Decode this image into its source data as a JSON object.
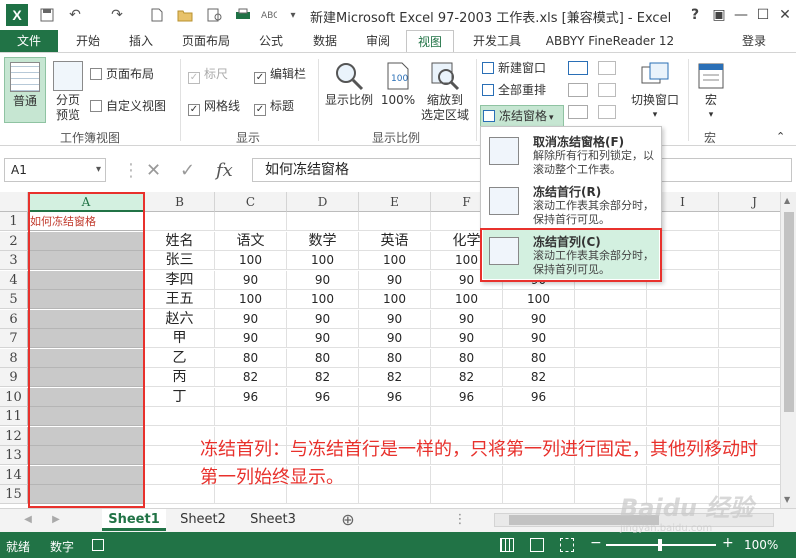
{
  "window": {
    "title": "新建Microsoft Excel 97-2003 工作表.xls  [兼容模式] - Excel",
    "help": "?",
    "ribbon_display": "▣",
    "minimize": "—",
    "maximize": "☐",
    "close": "✕"
  },
  "tabs": {
    "file": "文件",
    "items": [
      "开始",
      "插入",
      "页面布局",
      "公式",
      "数据",
      "审阅",
      "视图",
      "开发工具",
      "ABBYY FineReader 12"
    ],
    "login": "登录"
  },
  "ribbon": {
    "workbook_views": {
      "normal": "普通",
      "page_break": [
        "分页",
        "预览"
      ],
      "page_layout": "页面布局",
      "custom_views": "自定义视图",
      "group_label": "工作簿视图"
    },
    "show": {
      "ruler": "标尺",
      "formula_bar": "编辑栏",
      "gridlines": "网格线",
      "headings": "标题",
      "group_label": "显示"
    },
    "zoom": {
      "zoom": "显示比例",
      "zoom100": "100%",
      "zoom_to_selection": [
        "缩放到",
        "选定区域"
      ],
      "group_label": "显示比例"
    },
    "window": {
      "new_window": "新建窗口",
      "arrange_all": "全部重排",
      "freeze_panes": "冻结窗格",
      "switch_windows": "切换窗口"
    },
    "macros": {
      "macro": "宏",
      "group_label": "宏"
    }
  },
  "formula_bar": {
    "name_box": "A1",
    "cancel": "✕",
    "enter": "✓",
    "fx": "fx",
    "content": "如何冻结窗格"
  },
  "grid": {
    "columns": [
      "A",
      "B",
      "C",
      "D",
      "E",
      "F",
      "G",
      "H",
      "I",
      "J"
    ],
    "rows": [
      "1",
      "2",
      "3",
      "4",
      "5",
      "6",
      "7",
      "8",
      "9",
      "10",
      "11",
      "12",
      "13",
      "14",
      "15"
    ],
    "a1_text": "如何冻结窗格",
    "headers": [
      "姓名",
      "语文",
      "数学",
      "英语",
      "化学"
    ],
    "data": [
      [
        "张三",
        "100",
        "100",
        "100",
        "100"
      ],
      [
        "李四",
        "90",
        "90",
        "90",
        "90",
        "90"
      ],
      [
        "王五",
        "100",
        "100",
        "100",
        "100",
        "100"
      ],
      [
        "赵六",
        "90",
        "90",
        "90",
        "90",
        "90"
      ],
      [
        "甲",
        "90",
        "90",
        "90",
        "90",
        "90"
      ],
      [
        "乙",
        "80",
        "80",
        "80",
        "80",
        "80"
      ],
      [
        "丙",
        "82",
        "82",
        "82",
        "82",
        "82"
      ],
      [
        "丁",
        "96",
        "96",
        "96",
        "96",
        "96"
      ]
    ]
  },
  "freeze_menu": {
    "unfreeze": {
      "title": "取消冻结窗格(F)",
      "desc": "解除所有行和列锁定，以滚动整个工作表。"
    },
    "top_row": {
      "title": "冻结首行(R)",
      "desc": "滚动工作表其余部分时，保持首行可见。"
    },
    "first_col": {
      "title": "冻结首列(C)",
      "desc": "滚动工作表其余部分时，保持首列可见。"
    }
  },
  "annotation": "冻结首列：与冻结首行是一样的，只将第一列进行固定，其他列移动时第一列始终显示。",
  "sheets": [
    "Sheet1",
    "Sheet2",
    "Sheet3"
  ],
  "add_sheet": "⊕",
  "status": {
    "ready": "就绪",
    "numlock": "数字",
    "zoom": "100%",
    "zoom_minus": "−",
    "zoom_plus": "+"
  },
  "watermark": "Baidu 经验",
  "watermark_url": "jingyan.baidu.com",
  "colors": {
    "excel_green": "#217346",
    "annotation_red": "#e8312c",
    "selected_column": "#c9c9c9"
  }
}
